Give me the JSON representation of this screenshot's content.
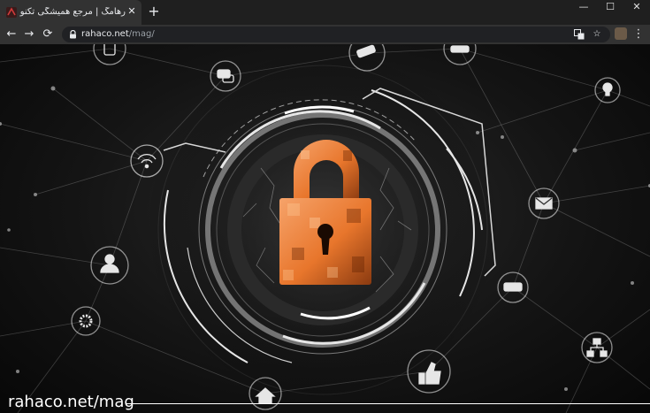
{
  "browser": {
    "tab": {
      "title": "رهامگ | مرجع همیشگی تکنولوژی |",
      "close": "✕"
    },
    "new_tab": "+",
    "window_controls": {
      "minimize": "—",
      "maximize": "☐",
      "close": "✕"
    },
    "nav": {
      "back": "←",
      "forward": "→",
      "reload": "⟳"
    },
    "address": {
      "domain": "rahaco.net",
      "path": "/mag/"
    },
    "omnibox_icons": {
      "translate": "translate-icon",
      "bookmark": "☆"
    },
    "menu": "⋮"
  },
  "page": {
    "watermark": "rahaco.net/mag",
    "colors": {
      "lock_orange": "#e8762c",
      "ring_white": "#e6e6e6",
      "background": "#121212"
    },
    "node_icons": [
      "mobile-phone-icon",
      "chat-bubble-icon",
      "security-camera-icon",
      "car-icon",
      "lightbulb-icon",
      "wifi-icon",
      "email-icon",
      "user-icon",
      "router-icon",
      "settings-gear-icon",
      "network-hierarchy-icon",
      "thumbs-up-icon",
      "home-icon"
    ]
  }
}
